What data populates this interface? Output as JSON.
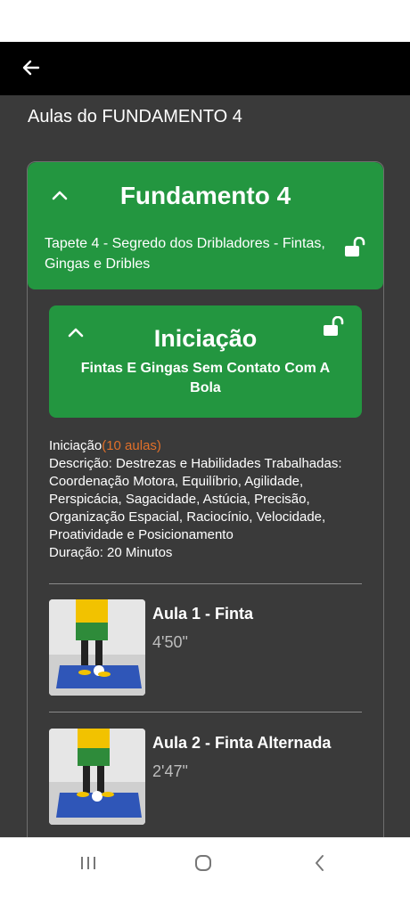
{
  "page": {
    "title": "Aulas do FUNDAMENTO 4"
  },
  "fundamento": {
    "title": "Fundamento 4",
    "subtitle": "Tapete 4 - Segredo dos Dribladores - Fintas, Gingas e Dribles"
  },
  "iniciacao": {
    "title": "Iniciação",
    "subtitle": "Fintas E Gingas Sem Contato Com A Bola",
    "label": "Iniciação",
    "count": "(10 aulas)",
    "description": "Descrição: Destrezas e Habilidades Trabalhadas: Coordenação Motora, Equilíbrio, Agilidade, Perspicácia, Sagacidade, Astúcia, Precisão, Organização Espacial, Raciocínio, Velocidade, Proatividade e Posicionamento",
    "duration": "Duração: 20 Minutos"
  },
  "lessons": [
    {
      "title": "Aula 1 - Finta",
      "duration": "4'50\""
    },
    {
      "title": "Aula 2 - Finta Alternada",
      "duration": "2'47\""
    }
  ],
  "icons": {
    "back": "arrow-left-icon",
    "collapse": "chevron-up-icon",
    "lock": "unlock-icon",
    "nav_recents": "recents-icon",
    "nav_home": "home-icon",
    "nav_back": "back-icon"
  },
  "colors": {
    "accent_green": "#239640",
    "background": "#3a3a3a",
    "count_orange": "#e0702a"
  }
}
